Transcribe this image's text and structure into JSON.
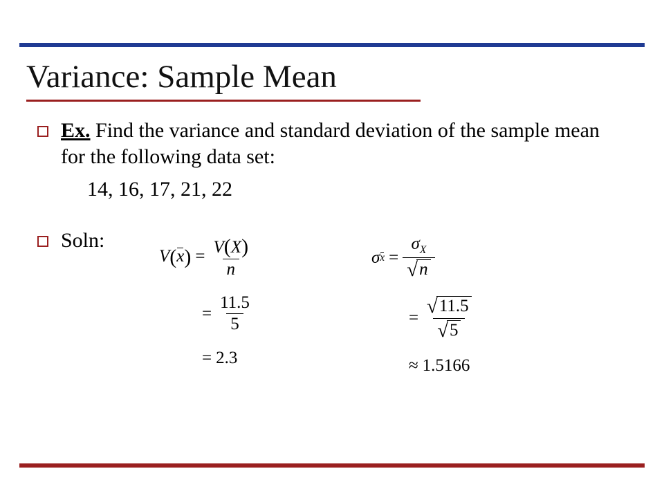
{
  "title": "Variance: Sample Mean",
  "bullets": {
    "ex_label": "Ex.",
    "ex_text": " Find the variance and standard deviation of the sample mean for the following data set:",
    "data_values": "14, 16, 17, 21, 22",
    "soln_label": "Soln:"
  },
  "math": {
    "variance": {
      "lhs_func": "V",
      "lhs_arg": "x",
      "eq1": "=",
      "rhs1_num_func": "V",
      "rhs1_num_arg": "X",
      "rhs1_den": "n",
      "eq2": "=",
      "rhs2_num": "11.5",
      "rhs2_den": "5",
      "eq3": "=",
      "result": "2.3"
    },
    "stddev": {
      "lhs_sym": "σ",
      "lhs_sub": "x",
      "eq1": "=",
      "rhs1_num_sym": "σ",
      "rhs1_num_sub": "X",
      "rhs1_den_sqrt": "n",
      "eq2": "=",
      "rhs2_num_sqrt": "11.5",
      "rhs2_den_sqrt": "5",
      "eq3": "≈",
      "result": "1.5166"
    }
  }
}
